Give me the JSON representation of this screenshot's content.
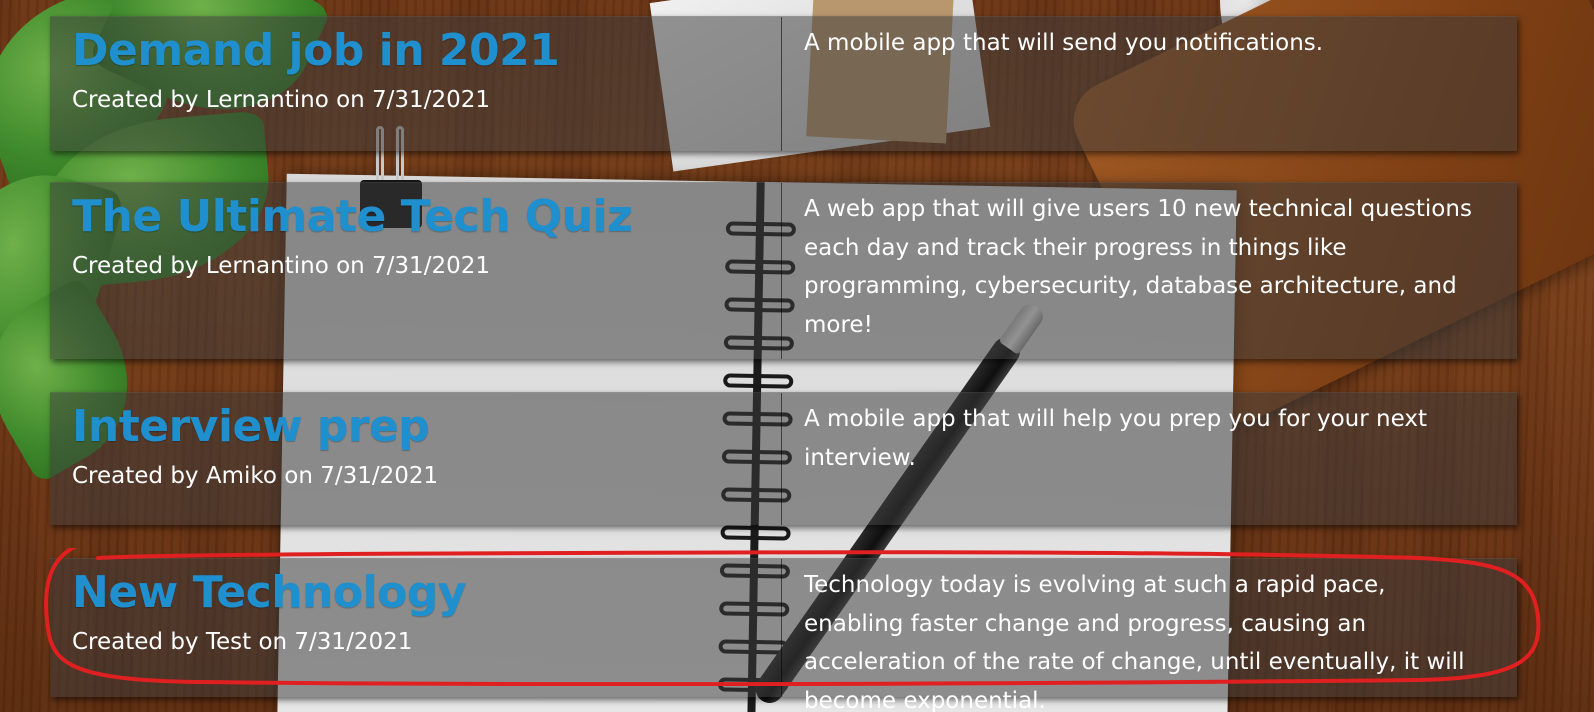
{
  "projects": [
    {
      "title": "Demand job in 2021",
      "author": "Lernantino",
      "date": "7/31/2021",
      "created_label": "Created by Lernantino on 7/31/2021",
      "description": "A mobile app that will send you notifications."
    },
    {
      "title": "The Ultimate Tech Quiz",
      "author": "Lernantino",
      "date": "7/31/2021",
      "created_label": "Created by Lernantino on 7/31/2021",
      "description": "A web app that will give users 10 new technical questions each day and track their progress in things like programming, cybersecurity, database architecture, and more!"
    },
    {
      "title": "Interview prep",
      "author": "Amiko",
      "date": "7/31/2021",
      "created_label": "Created by Amiko on 7/31/2021",
      "description": "A mobile app that will help you prep you for your next interview."
    },
    {
      "title": "New Technology",
      "author": "Test",
      "date": "7/31/2021",
      "created_label": "Created by Test on 7/31/2021",
      "description": "Technology today is evolving at such a rapid pace, enabling faster change and progress, causing an acceleration of the rate of change, until eventually, it will become exponential.",
      "highlighted": true
    }
  ],
  "colors": {
    "title": "#1f8fce",
    "highlight_ring": "#e02020",
    "row_bg": "rgba(60,60,60,0.52)"
  }
}
